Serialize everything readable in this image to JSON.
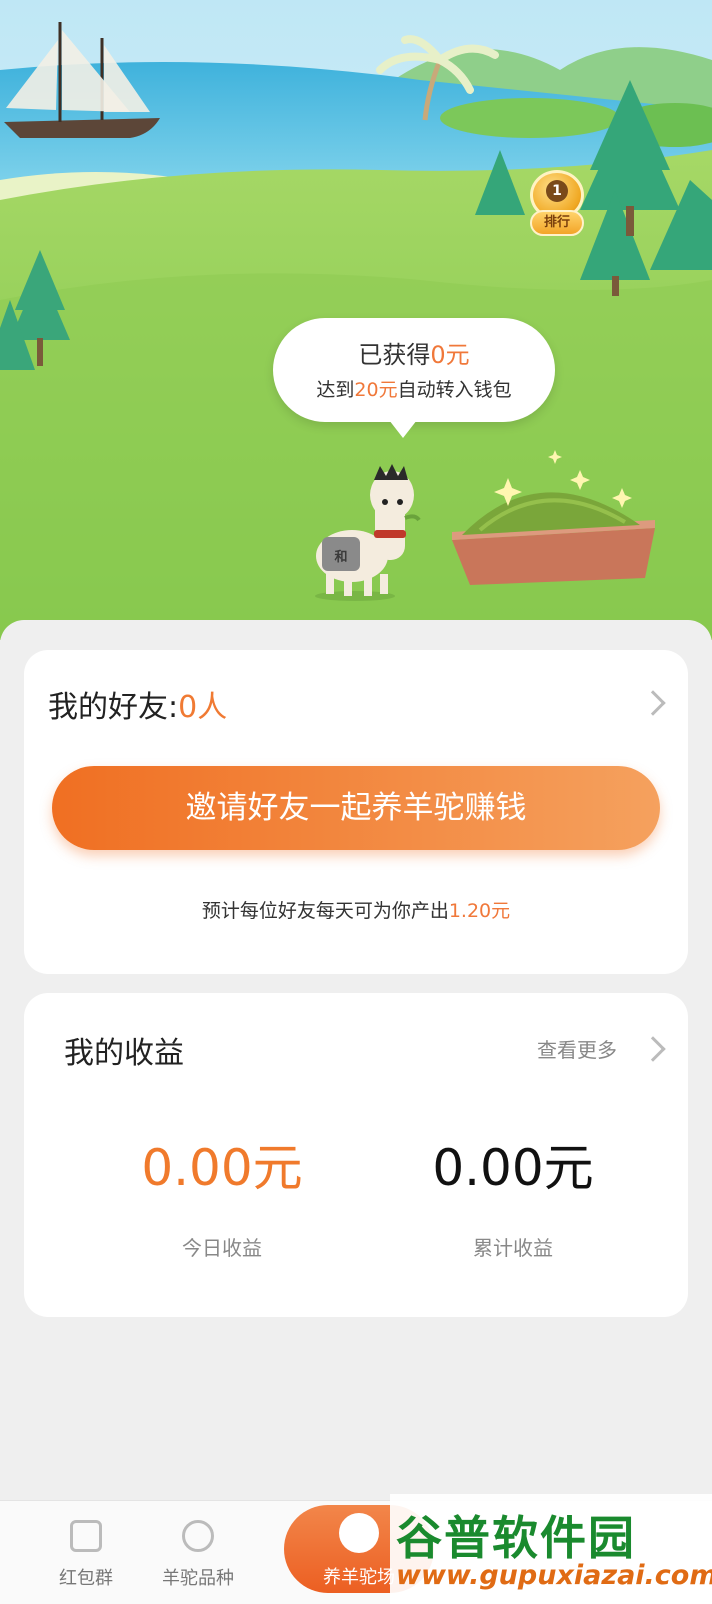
{
  "scene": {
    "rank": {
      "number": "1",
      "label": "排行"
    },
    "speech": {
      "earned_prefix": "已获得",
      "earned_amount": "0元",
      "goal_prefix": "达到",
      "goal_amount": "20元",
      "goal_suffix": "自动转入钱包"
    },
    "alpaca_saddle_text": "和"
  },
  "friends": {
    "title": "我的好友:",
    "count": "0人",
    "invite_button": "邀请好友一起养羊驼赚钱",
    "hint_prefix": "预计每位好友每天可为你产出",
    "hint_amount": "1.20元"
  },
  "income": {
    "title": "我的收益",
    "more": "查看更多",
    "today_amount": "0.00元",
    "today_label": "今日收益",
    "total_amount": "0.00元",
    "total_label": "累计收益"
  },
  "tabs": {
    "redpacket": "红包群",
    "breeds": "羊驼品种",
    "farm": "养羊驼场"
  },
  "watermark": {
    "brand": "谷普软件园",
    "site": "www.gupuxiazai.com"
  },
  "colors": {
    "accent": "#f07a2c",
    "grass": "#8fcf55",
    "sea": "#57c1e3"
  }
}
